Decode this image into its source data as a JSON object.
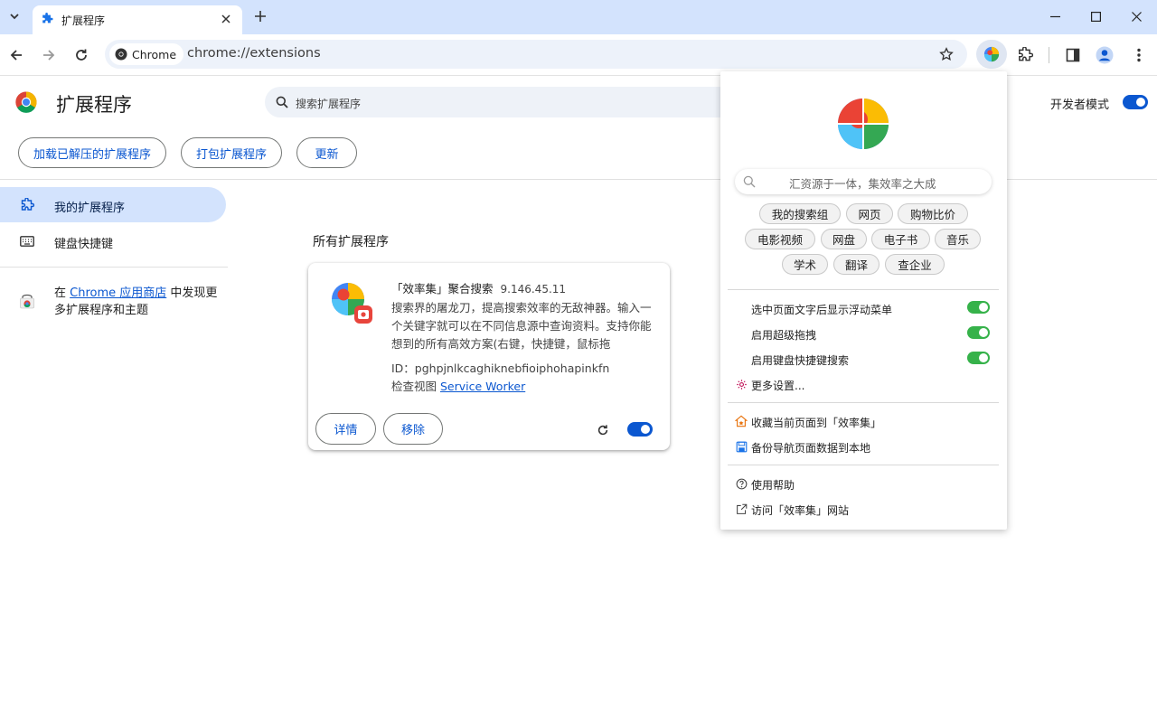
{
  "tab": {
    "title": "扩展程序"
  },
  "omnibox": {
    "chip": "Chrome",
    "url": "chrome://extensions"
  },
  "page": {
    "title": "扩展程序",
    "search_placeholder": "搜索扩展程序",
    "dev_mode_label": "开发者模式",
    "dev_mode": true,
    "buttons": {
      "load_unpacked": "加载已解压的扩展程序",
      "pack": "打包扩展程序",
      "update": "更新"
    }
  },
  "sidebar": {
    "my_extensions": "我的扩展程序",
    "keyboard_shortcuts": "键盘快捷键",
    "store_prefix": "在",
    "store_link": "Chrome 应用商店",
    "store_suffix": "中发现更多扩展程序和主题"
  },
  "main": {
    "section_title": "所有扩展程序",
    "extension": {
      "name": "「效率集」聚合搜索",
      "version": "9.146.45.11",
      "description": "搜索界的屠龙刀，提高搜索效率的无敌神器。输入一个关键字就可以在不同信息源中查询资料。支持你能想到的所有高效方案(右键，快捷键，鼠标拖",
      "id": "ID：pghpjnlkcaghiknebfioiphohapinkfn",
      "inspect_label": "检查视图",
      "inspect_link": "Service Worker",
      "details_button": "详情",
      "remove_button": "移除",
      "enabled": true
    }
  },
  "popup": {
    "search_placeholder": "汇资源于一体，集效率之大成",
    "tags": [
      "我的搜索组",
      "网页",
      "购物比价",
      "电影视频",
      "网盘",
      "电子书",
      "音乐",
      "学术",
      "翻译",
      "查企业"
    ],
    "toggles": [
      {
        "label": "选中页面文字后显示浮动菜单",
        "on": true
      },
      {
        "label": "启用超级拖拽",
        "on": true
      },
      {
        "label": "启用键盘快捷键搜索",
        "on": true
      }
    ],
    "more_settings": "更多设置...",
    "bookmark": "收藏当前页面到「效率集」",
    "backup": "备份导航页面数据到本地",
    "help": "使用帮助",
    "visit": "访问「效率集」网站"
  },
  "colors": {
    "accent": "#0b57d0",
    "tab_strip": "#d3e3fd",
    "toggle_green": "#36b24a"
  }
}
